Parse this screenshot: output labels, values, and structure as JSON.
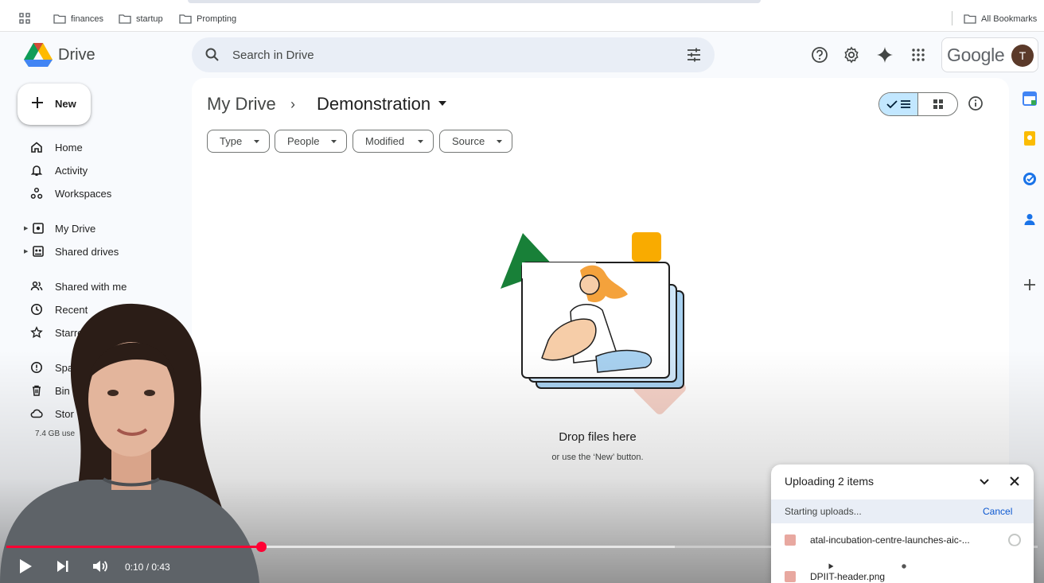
{
  "bookmarks": {
    "items": [
      "finances",
      "startup",
      "Prompting"
    ],
    "all_label": "All Bookmarks"
  },
  "header": {
    "app_name": "Drive",
    "search_placeholder": "Search in Drive",
    "google_label": "Google",
    "avatar_letter": "T"
  },
  "sidebar": {
    "new_label": "New",
    "items": [
      {
        "label": "Home",
        "icon": "home-icon"
      },
      {
        "label": "Activity",
        "icon": "bell-icon"
      },
      {
        "label": "Workspaces",
        "icon": "workspaces-icon"
      },
      {
        "label": "My Drive",
        "icon": "my-drive-icon"
      },
      {
        "label": "Shared drives",
        "icon": "shared-drives-icon"
      },
      {
        "label": "Shared with me",
        "icon": "people-icon"
      },
      {
        "label": "Recent",
        "icon": "clock-icon"
      },
      {
        "label": "Starre",
        "icon": "star-icon"
      },
      {
        "label": "Spar",
        "icon": "spam-icon"
      },
      {
        "label": "Bin",
        "icon": "trash-icon"
      },
      {
        "label": "Stor",
        "icon": "cloud-icon"
      }
    ],
    "storage_text": "7.4 GB use"
  },
  "main": {
    "breadcrumb_root": "My Drive",
    "breadcrumb_current": "Demonstration",
    "filters": [
      "Type",
      "People",
      "Modified",
      "Source"
    ],
    "empty_title": "Drop files here",
    "empty_subtitle": "or use the ‘New’ button."
  },
  "upload": {
    "title": "Uploading 2 items",
    "status": "Starting uploads...",
    "cancel_label": "Cancel",
    "files": [
      "atal-incubation-centre-launches-aic-...",
      "DPIIT-header.png"
    ]
  },
  "video": {
    "time": "0:10 / 0:43",
    "progress": 0.247,
    "buffered": 0.648
  },
  "colors": {
    "accent_blue": "#0b57d0",
    "toggle_selected": "#c2e7ff",
    "youtube_red": "#ff0033"
  }
}
